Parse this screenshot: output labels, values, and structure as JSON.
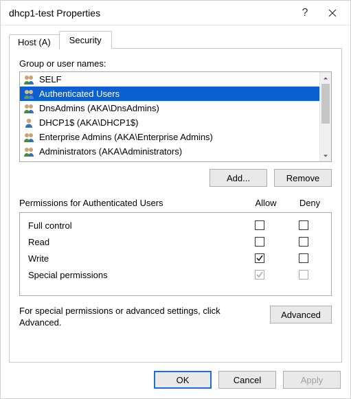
{
  "window": {
    "title": "dhcp1-test Properties"
  },
  "tabs": {
    "host": "Host (A)",
    "security": "Security"
  },
  "groupnames": {
    "label": "Group or user names:",
    "items": [
      {
        "label": "SELF"
      },
      {
        "label": "Authenticated Users"
      },
      {
        "label": "DnsAdmins (AKA\\DnsAdmins)"
      },
      {
        "label": "DHCP1$ (AKA\\DHCP1$)"
      },
      {
        "label": "Enterprise Admins (AKA\\Enterprise Admins)"
      },
      {
        "label": "Administrators (AKA\\Administrators)"
      }
    ]
  },
  "buttons": {
    "add": "Add...",
    "remove": "Remove",
    "advanced": "Advanced",
    "ok": "OK",
    "cancel": "Cancel",
    "apply": "Apply"
  },
  "permissions": {
    "header_label": "Permissions for Authenticated Users",
    "col_allow": "Allow",
    "col_deny": "Deny",
    "rows": [
      {
        "name": "Full control"
      },
      {
        "name": "Read"
      },
      {
        "name": "Write"
      },
      {
        "name": "Special permissions"
      }
    ]
  },
  "advanced_text": "For special permissions or advanced settings, click Advanced."
}
